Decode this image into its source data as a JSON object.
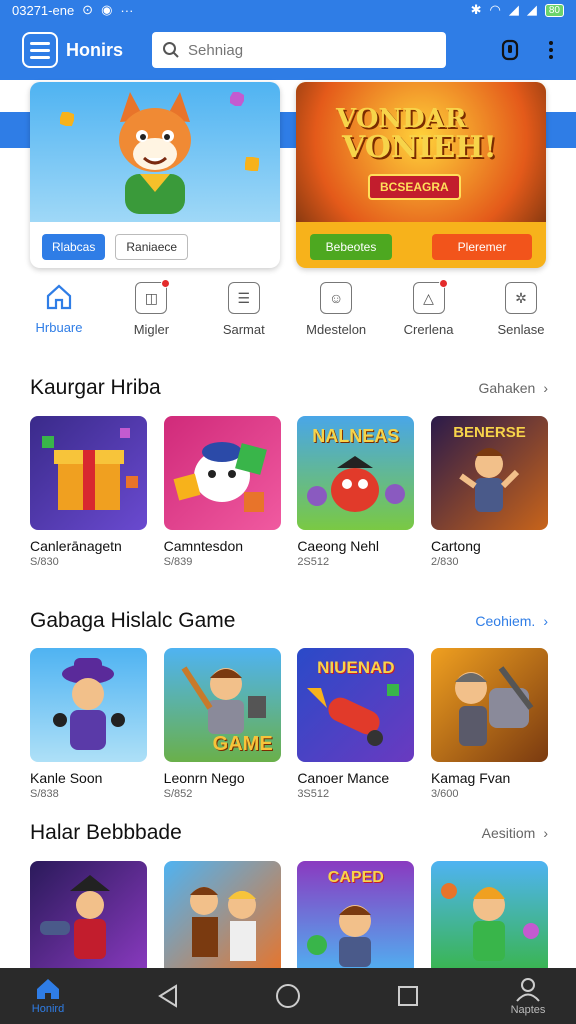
{
  "status": {
    "time": "03271-ene",
    "battery": "80"
  },
  "header": {
    "title": "Honirs",
    "search_placeholder": "Sehniag"
  },
  "banners": [
    {
      "btn1": "Rlabcas",
      "btn2": "Raniaece"
    },
    {
      "art_title": "VONDAR",
      "art_title2": "VONIEH!",
      "art_sub": "BCSEAGRA",
      "btn1": "Bebeotes",
      "btn2": "Pleremer"
    }
  ],
  "categories": [
    {
      "label": "Hrbuare",
      "icon": "home-icon",
      "active": true
    },
    {
      "label": "Migler",
      "icon": "message-icon"
    },
    {
      "label": "Sarmat",
      "icon": "list-icon"
    },
    {
      "label": "Mdestelon",
      "icon": "face-icon"
    },
    {
      "label": "Crerlena",
      "icon": "warning-icon"
    },
    {
      "label": "Senlase",
      "icon": "sparkle-icon"
    }
  ],
  "sections": [
    {
      "title": "Kaurgar Hriba",
      "more": "Gahaken",
      "games": [
        {
          "name": "Canlerānagetn",
          "size": "S/830"
        },
        {
          "name": "Camntesdon",
          "size": "S/839"
        },
        {
          "name": "Caeong Nehl",
          "size": "2S512"
        },
        {
          "name": "Cartong",
          "size": "2/830"
        }
      ]
    },
    {
      "title": "Gabaga Hislalc Game",
      "more": "Ceohiem.",
      "games": [
        {
          "name": "Kanle Soon",
          "size": "S/838"
        },
        {
          "name": "Leonrn Nego",
          "size": "S/852"
        },
        {
          "name": "Canoer Mance",
          "size": "3S512"
        },
        {
          "name": "Kamag Fvan",
          "size": "3/600"
        }
      ]
    },
    {
      "title": "Halar Bebbbade",
      "more": "Aesitiom",
      "games": [
        {},
        {},
        {},
        {}
      ]
    }
  ],
  "art": {
    "game_text": "GAME",
    "row1_c3": "NALNEAS",
    "row1_c4": "BENERSE",
    "row2_c3": "NIUENAD",
    "row3_c3": "CAPED"
  },
  "nav": {
    "home": "Honird",
    "profile": "Naptes"
  },
  "colors": {
    "accent": "#2f7de6",
    "nav_bg": "#2a2a2a"
  }
}
